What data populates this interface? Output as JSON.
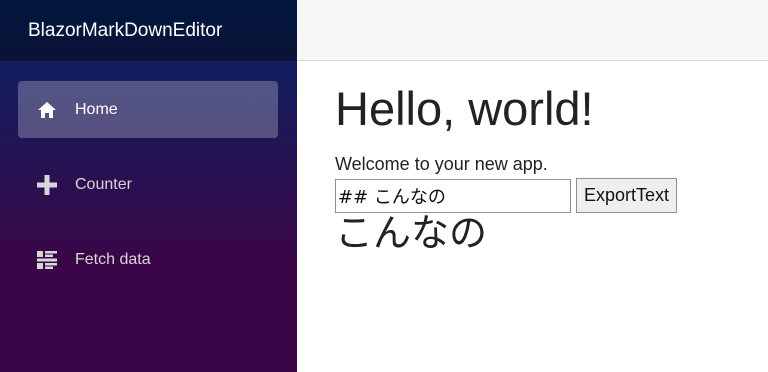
{
  "app": {
    "brand": "BlazorMarkDownEditor"
  },
  "sidebar": {
    "items": [
      {
        "label": "Home",
        "icon": "home-icon",
        "active": true
      },
      {
        "label": "Counter",
        "icon": "plus-icon",
        "active": false
      },
      {
        "label": "Fetch data",
        "icon": "list-rich-icon",
        "active": false
      }
    ]
  },
  "main": {
    "title": "Hello, world!",
    "welcome": "Welcome to your new app.",
    "editor": {
      "value": "## こんなの"
    },
    "export_label": "ExportText",
    "preview_heading": "こんなの"
  },
  "colors": {
    "sidebar_top": "#052767",
    "sidebar_bottom": "#3a0647",
    "active_item_bg": "rgba(255,255,255,0.25)",
    "top_row_bg": "#f7f7f7"
  }
}
